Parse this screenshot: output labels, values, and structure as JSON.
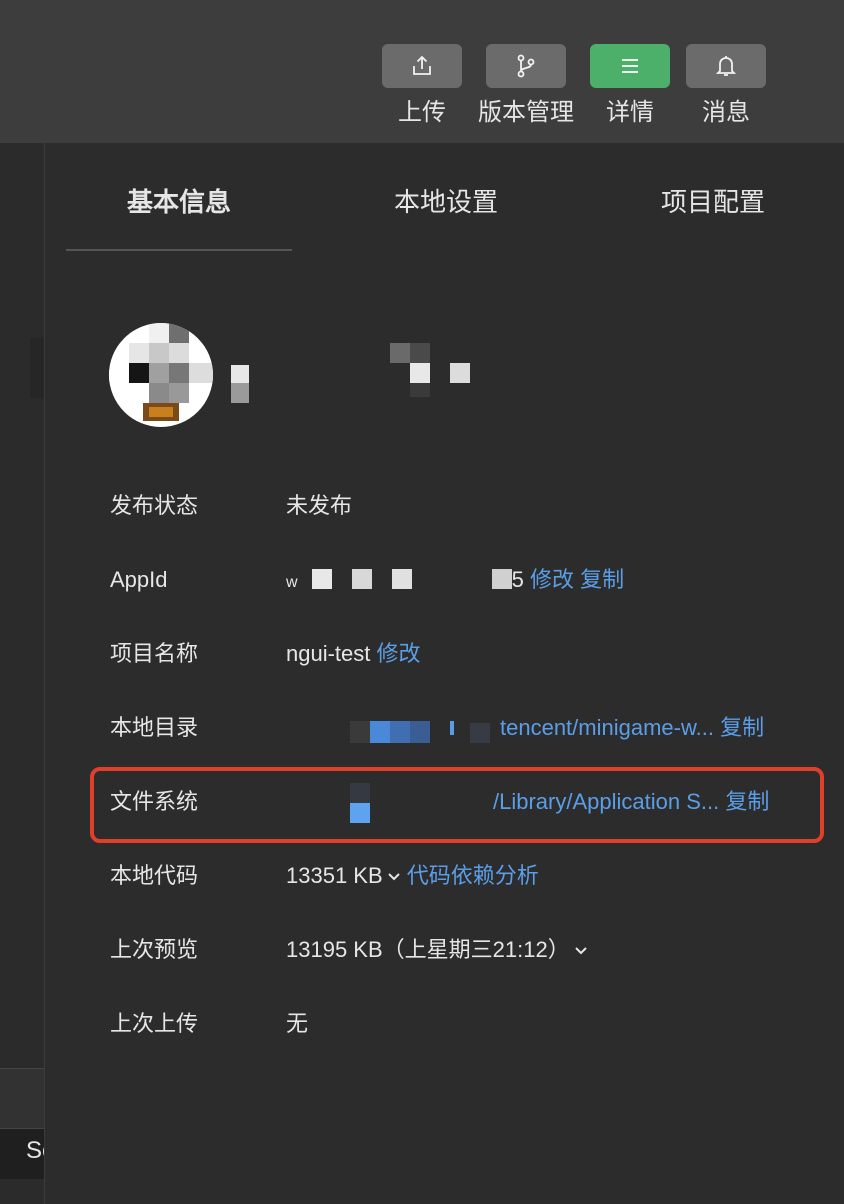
{
  "toolbar": {
    "buttons": [
      {
        "label": "上传",
        "icon": "upload-icon"
      },
      {
        "label": "版本管理",
        "icon": "branch-icon"
      },
      {
        "label": "详情",
        "icon": "menu-icon"
      },
      {
        "label": "消息",
        "icon": "bell-icon"
      }
    ],
    "active_color": "#4caf6a"
  },
  "left_strip": {
    "partial_text": "Se"
  },
  "tabs": [
    {
      "label": "基本信息",
      "active": true
    },
    {
      "label": "本地设置",
      "active": false
    },
    {
      "label": "项目配置",
      "active": false
    }
  ],
  "info": {
    "publish_status": {
      "label": "发布状态",
      "value": "未发布"
    },
    "appid": {
      "label": "AppId",
      "value_prefix": "w",
      "value_suffix": "5",
      "edit": "修改",
      "copy": "复制"
    },
    "project_name": {
      "label": "项目名称",
      "value": "ngui-test",
      "edit": "修改"
    },
    "local_dir": {
      "label": "本地目录",
      "value": "tencent/minigame-w...",
      "copy": "复制"
    },
    "file_system": {
      "label": "文件系统",
      "value": "/Library/Application S...",
      "copy": "复制"
    },
    "local_code": {
      "label": "本地代码",
      "value": "13351 KB",
      "action": "代码依赖分析"
    },
    "last_preview": {
      "label": "上次预览",
      "value": "13195 KB（上星期三21:12）"
    },
    "last_upload": {
      "label": "上次上传",
      "value": "无"
    }
  },
  "colors": {
    "link": "#5b9ee8",
    "highlight": "#e0402a",
    "panel": "#2c2c2c"
  }
}
